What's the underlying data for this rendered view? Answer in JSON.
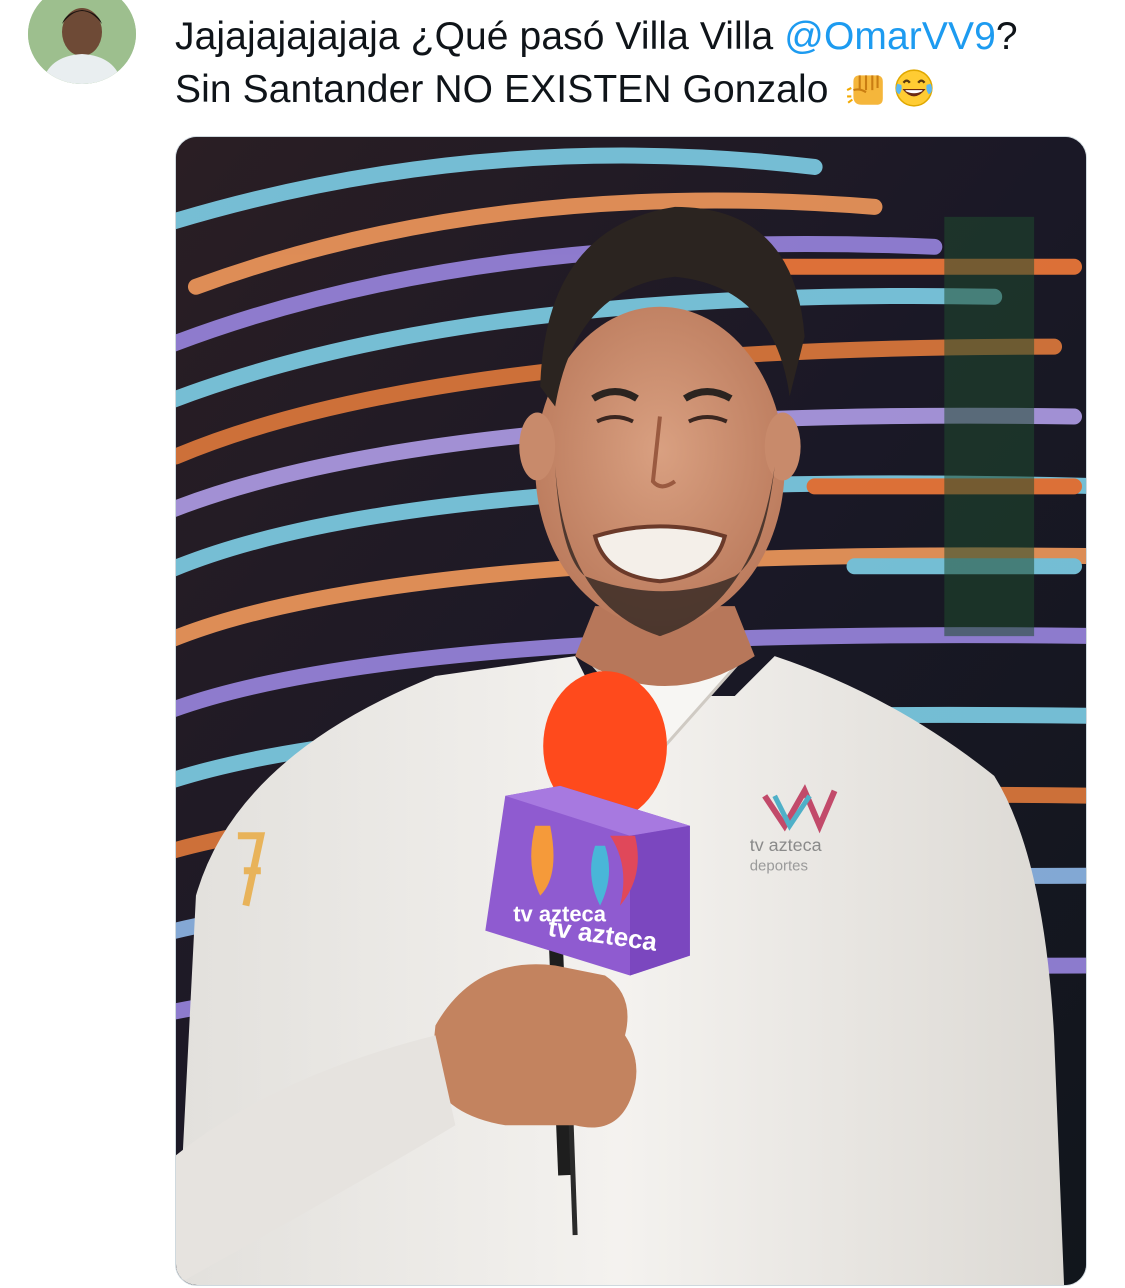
{
  "tweet": {
    "line1_text": "Jajajajajajaja ¿Qué pasó Villa Villa ",
    "mention": "@OmarVV9",
    "line1_end": "?",
    "line2_text": "Sin Santander NO EXISTEN Gonzalo ",
    "emojis": [
      "punch-emoji",
      "tears-of-joy-emoji"
    ]
  },
  "media": {
    "mic_cube_text": "tv azteca",
    "mic_cube_side_text": "tv azteca",
    "shirt_logo_line1": "tv azteca",
    "shirt_logo_line2": "deportes"
  },
  "colors": {
    "mention": "#1d9bf0",
    "text": "#0f1419",
    "mic_cube": "#8f5bd0",
    "mic_foam": "#ff4a1c"
  }
}
